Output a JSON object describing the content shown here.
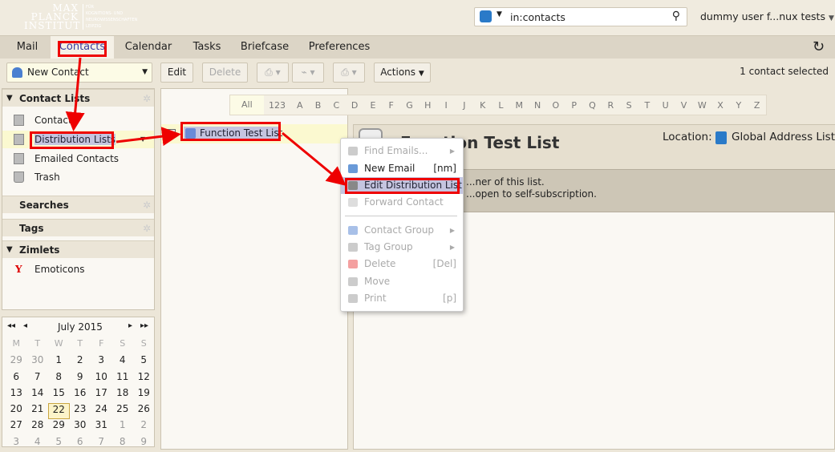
{
  "header": {
    "logo": {
      "line1": "MAX",
      "line2": "PLANCK",
      "line3": "INSTITUT",
      "sub1": "FÜR",
      "sub2": "KOGNITIONS- UND",
      "sub3": "NEUROWISSENSCHAFTEN",
      "sub4": "LEIPZIG"
    },
    "search_value": "in:contacts",
    "user": "dummy user f...nux tests"
  },
  "tabs": [
    "Mail",
    "Contacts",
    "Calendar",
    "Tasks",
    "Briefcase",
    "Preferences"
  ],
  "toolbar": {
    "new_contact": "New Contact",
    "edit": "Edit",
    "delete": "Delete",
    "actions": "Actions",
    "status": "1 contact selected"
  },
  "sidebar": {
    "contact_lists": "Contact Lists",
    "items": [
      "Contacts",
      "Distribution Lists",
      "Emailed Contacts",
      "Trash"
    ],
    "searches": "Searches",
    "tags": "Tags",
    "zimlets": "Zimlets",
    "zimlet_items": [
      "Emoticons"
    ]
  },
  "calendar": {
    "month": "July 2015",
    "weekdays": [
      "M",
      "T",
      "W",
      "T",
      "F",
      "S",
      "S"
    ],
    "days": [
      [
        "29",
        "30",
        "1",
        "2",
        "3",
        "4",
        "5"
      ],
      [
        "6",
        "7",
        "8",
        "9",
        "10",
        "11",
        "12"
      ],
      [
        "13",
        "14",
        "15",
        "16",
        "17",
        "18",
        "19"
      ],
      [
        "20",
        "21",
        "22",
        "23",
        "24",
        "25",
        "26"
      ],
      [
        "27",
        "28",
        "29",
        "30",
        "31",
        "1",
        "2"
      ],
      [
        "3",
        "4",
        "5",
        "6",
        "7",
        "8",
        "9"
      ]
    ],
    "today": "22"
  },
  "alphabet": [
    "All",
    "123",
    "A",
    "B",
    "C",
    "D",
    "E",
    "F",
    "G",
    "H",
    "I",
    "J",
    "K",
    "L",
    "M",
    "N",
    "O",
    "P",
    "Q",
    "R",
    "S",
    "T",
    "U",
    "V",
    "W",
    "X",
    "Y",
    "Z"
  ],
  "list": {
    "item": "Function Test List"
  },
  "detail": {
    "title": "Function Test List",
    "location_label": "Location:",
    "location": "Global Address List",
    "note1": "...ner of this list.",
    "note2": "...open to self-subscription."
  },
  "context_menu": [
    {
      "label": "Find Emails...",
      "shortcut": "",
      "submenu": true,
      "enabled": false
    },
    {
      "label": "New Email",
      "shortcut": "[nm]",
      "submenu": false,
      "enabled": true
    },
    {
      "label": "Edit Distribution List",
      "shortcut": "",
      "submenu": false,
      "enabled": true,
      "highlighted": true
    },
    {
      "label": "Forward Contact",
      "shortcut": "",
      "submenu": false,
      "enabled": false
    },
    {
      "label": "Contact Group",
      "shortcut": "",
      "submenu": true,
      "enabled": false
    },
    {
      "label": "Tag Group",
      "shortcut": "",
      "submenu": true,
      "enabled": false
    },
    {
      "label": "Delete",
      "shortcut": "[Del]",
      "submenu": false,
      "enabled": false
    },
    {
      "label": "Move",
      "shortcut": "",
      "submenu": false,
      "enabled": false
    },
    {
      "label": "Print",
      "shortcut": "[p]",
      "submenu": false,
      "enabled": false
    }
  ],
  "colors": {
    "annotation": "#e00000",
    "selection": "#c5c5e0",
    "row_highlight": "#fbf9d0"
  }
}
